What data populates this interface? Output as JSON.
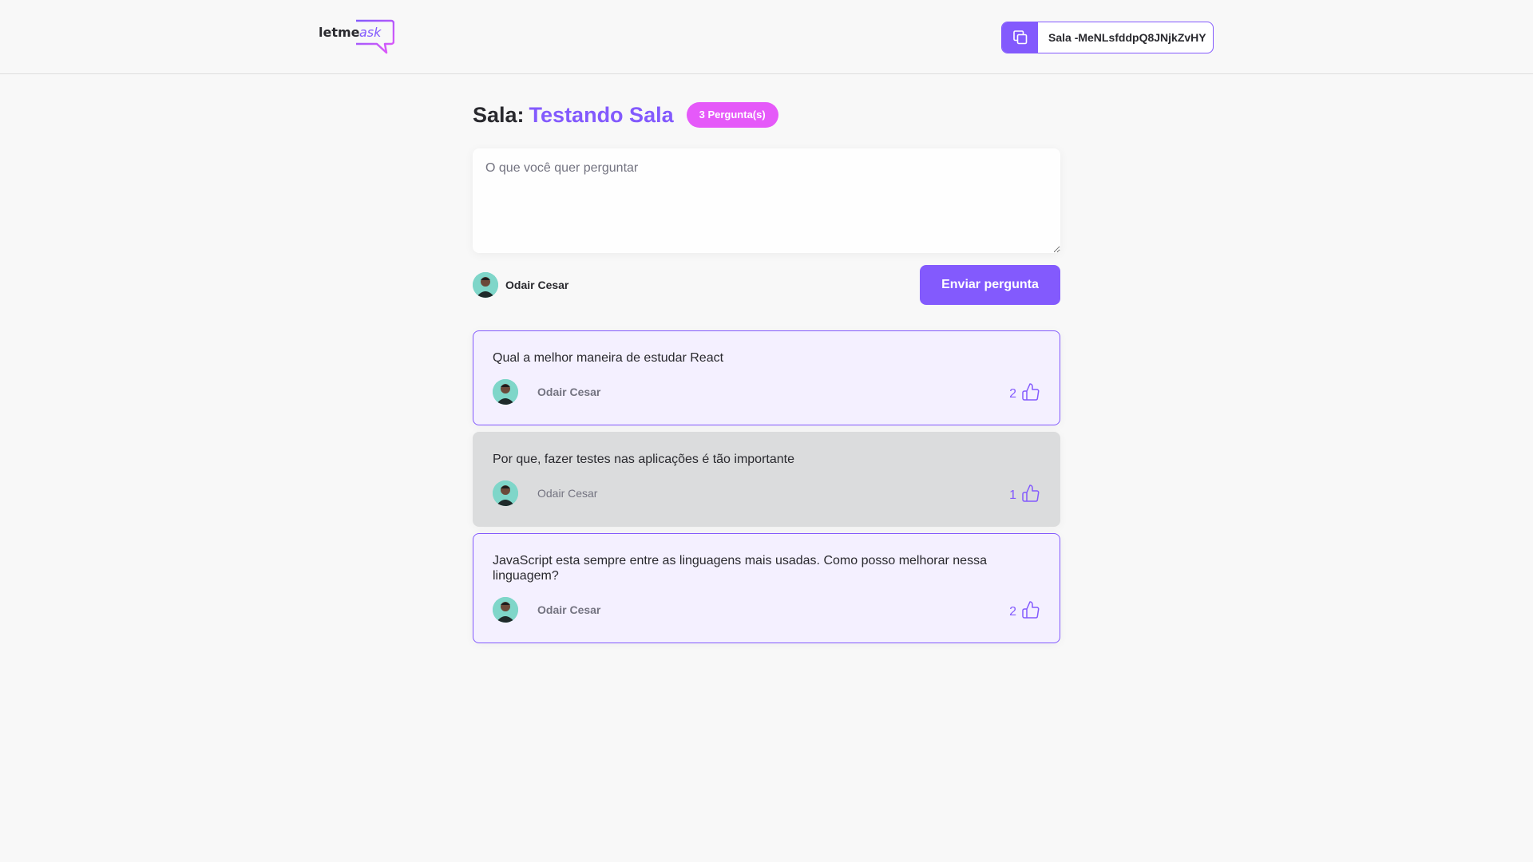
{
  "app": {
    "logo_text": "letmeask"
  },
  "header": {
    "room_code_label": "Sala -MeNLsfddpQ8JNjkZvHY"
  },
  "room": {
    "title_prefix": "Sala:",
    "title_name": "Testando Sala",
    "question_count_badge": "3 Pergunta(s)"
  },
  "form": {
    "placeholder": "O que você quer perguntar",
    "value": "",
    "user_name": "Odair Cesar",
    "send_label": "Enviar pergunta"
  },
  "questions": [
    {
      "content": "Qual a melhor maneira de estudar React",
      "author": "Odair Cesar",
      "likes": "2",
      "state": "highlighted"
    },
    {
      "content": "Por que, fazer testes nas aplicações é tão importante",
      "author": "Odair Cesar",
      "likes": "1",
      "state": "answered"
    },
    {
      "content": "JavaScript esta sempre entre as linguagens mais usadas. Como posso melhorar nessa linguagem?",
      "author": "Odair Cesar",
      "likes": "2",
      "state": "highlighted"
    }
  ],
  "colors": {
    "primary": "#835afd",
    "pink": "#e559f9",
    "highlight_bg": "#f4f0ff",
    "answered_bg": "#dbdcdd",
    "page_bg": "#f8f8f8",
    "text": "#29292e",
    "muted": "#737380"
  },
  "icons": {
    "copy": "copy-icon",
    "like": "thumbs-up-icon",
    "logo": "speech-bubble-logo"
  }
}
